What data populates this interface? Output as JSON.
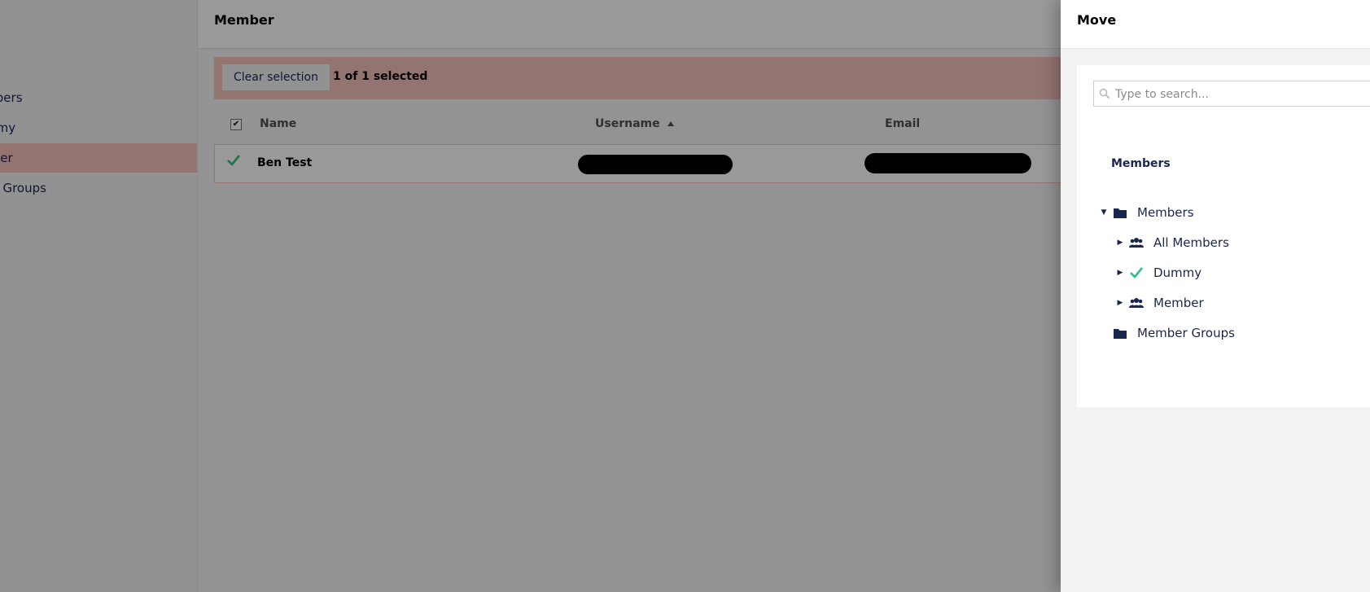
{
  "sidebar": {
    "items": [
      {
        "label": "Members"
      },
      {
        "label": "Dummy"
      },
      {
        "label": "Member"
      },
      {
        "label": "Member Groups"
      }
    ]
  },
  "header": {
    "title": "Member"
  },
  "selection": {
    "clear_label": "Clear selection",
    "count_text": "1 of 1 selected"
  },
  "table": {
    "columns": {
      "name": "Name",
      "username": "Username",
      "email": "Email"
    },
    "rows": [
      {
        "name": "Ben Test",
        "username": "[redacted]",
        "email": "[redacted]"
      }
    ]
  },
  "panel": {
    "title": "Move",
    "search_placeholder": "Type to search...",
    "section_title": "Members",
    "tree": [
      {
        "label": "Members",
        "icon": "folder-icon",
        "expanded": true
      },
      {
        "label": "All Members",
        "icon": "users-icon"
      },
      {
        "label": "Dummy",
        "icon": "check-icon"
      },
      {
        "label": "Member",
        "icon": "users-icon"
      },
      {
        "label": "Member Groups",
        "icon": "folder-icon"
      }
    ]
  },
  "colors": {
    "accent": "#f5c1bc",
    "text": "#1b264f",
    "check": "#2bc37c"
  }
}
